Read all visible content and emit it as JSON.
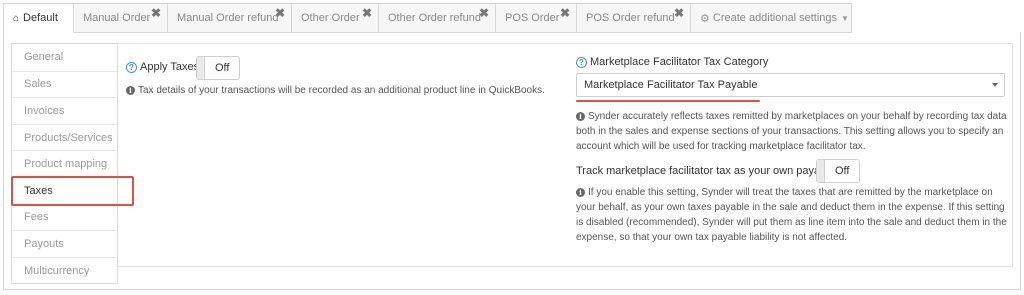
{
  "tabs": [
    {
      "label": "Default",
      "icon": "home-icon",
      "active": true
    },
    {
      "label": "Manual Order",
      "closable": true
    },
    {
      "label": "Manual Order refund",
      "closable": true
    },
    {
      "label": "Other Order",
      "closable": true
    },
    {
      "label": "Other Order refund",
      "closable": true
    },
    {
      "label": "POS Order",
      "closable": true
    },
    {
      "label": "POS Order refund",
      "closable": true
    },
    {
      "label": "Create additional settings",
      "icon": "gear-icon",
      "dropdown": true
    }
  ],
  "sidebar": {
    "items": [
      {
        "label": "General"
      },
      {
        "label": "Sales"
      },
      {
        "label": "Invoices"
      },
      {
        "label": "Products/Services"
      },
      {
        "label": "Product mapping"
      },
      {
        "label": "Taxes",
        "active": true
      },
      {
        "label": "Fees"
      },
      {
        "label": "Payouts"
      },
      {
        "label": "Multicurrency"
      }
    ]
  },
  "apply_taxes": {
    "label": "Apply Taxes",
    "toggle": "Off",
    "note": "Tax details of your transactions will be recorded as an additional product line in QuickBooks."
  },
  "marketplace": {
    "label": "Marketplace Facilitator Tax Category",
    "selected": "Marketplace Facilitator Tax Payable",
    "description": "Synder accurately reflects taxes remitted by marketplaces on your behalf by recording tax data both in the sales and expense sections of your transactions. This setting allows you to specify an account which will be used for tracking marketplace facilitator tax.",
    "track_label": "Track marketplace facilitator tax as your own payable",
    "track_toggle": "Off",
    "track_description": "If you enable this setting, Synder will treat the taxes that are remitted by the marketplace on your behalf, as your own taxes payable in the sale and deduct them in the expense. If this setting is disabled (recommended), Synder will put them as line item into the sale and deduct them in the expense, so that your own tax payable liability is not affected."
  },
  "colors": {
    "accent_red": "#e0523f",
    "link_blue": "#4a90c9"
  }
}
